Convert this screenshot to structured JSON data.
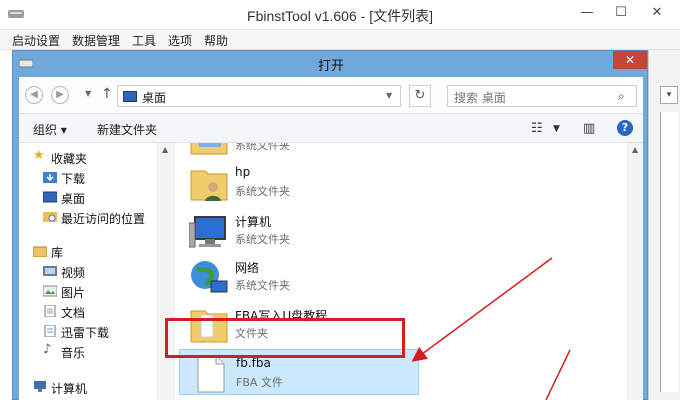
{
  "app": {
    "title": "FbinstTool v1.606 - [文件列表]",
    "controls": {
      "minimize": "—",
      "maximize": "☐",
      "close": "✕"
    },
    "menu": [
      "启动设置",
      "数据管理",
      "工具",
      "选项",
      "帮助"
    ]
  },
  "dialog": {
    "title": "打开",
    "close": "✕",
    "address": {
      "location": "桌面"
    },
    "search": {
      "placeholder": "搜索 桌面"
    },
    "toolbar": {
      "organize": "组织 ▾",
      "new_folder": "新建文件夹"
    },
    "nav": {
      "favorites_label": "收藏夹",
      "downloads_label": "下载",
      "desktop_label": "桌面",
      "recent_label": "最近访问的位置",
      "libraries_label": "库",
      "videos_label": "视频",
      "pictures_label": "图片",
      "documents_label": "文档",
      "thunder_label": "迅雷下载",
      "music_label": "音乐",
      "computer_label": "计算机"
    },
    "files": [
      {
        "name": "",
        "type": "系统文件夹",
        "icon": "folder-icon"
      },
      {
        "name": "hp",
        "type": "系统文件夹",
        "icon": "user-folder-icon"
      },
      {
        "name": "计算机",
        "type": "系统文件夹",
        "icon": "computer-icon"
      },
      {
        "name": "网络",
        "type": "系统文件夹",
        "icon": "network-icon"
      },
      {
        "name": "FBA写入U盘教程",
        "type": "文件夹",
        "icon": "folder-icon"
      },
      {
        "name": "fb.fba",
        "type": "FBA 文件",
        "icon": "file-icon"
      }
    ]
  },
  "colors": {
    "dialog_frame": "#6fa9dc",
    "selection": "#cce8ff",
    "annotation_red": "#d31f1f"
  }
}
